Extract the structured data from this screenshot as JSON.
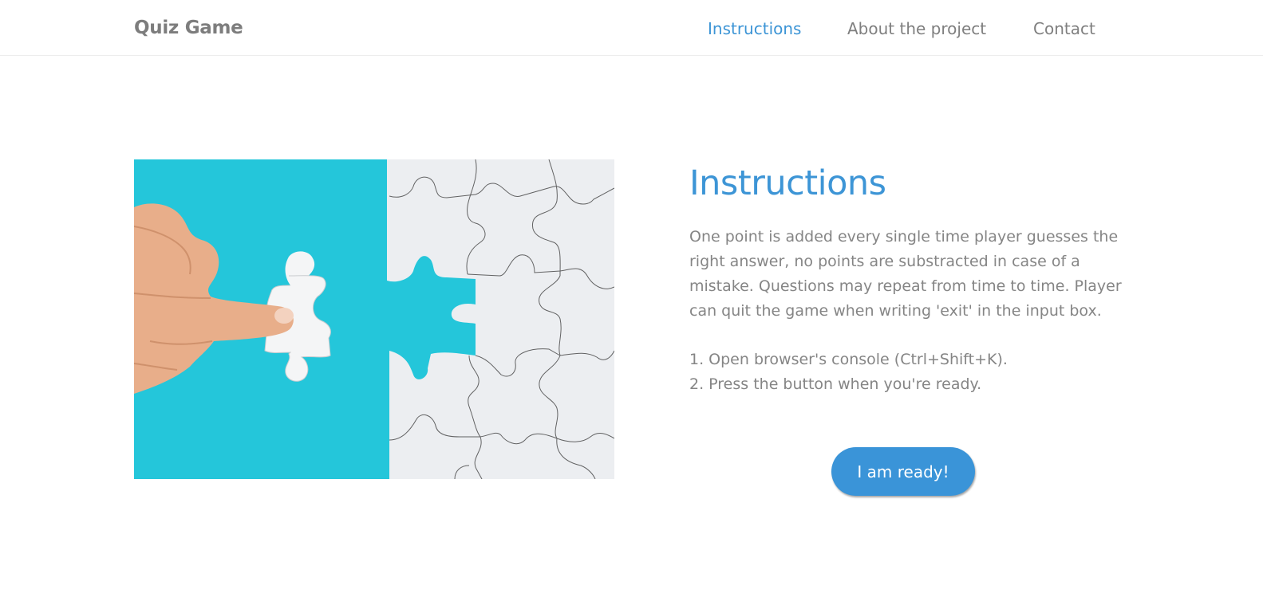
{
  "navbar": {
    "brand": "Quiz Game",
    "links": [
      {
        "label": "Instructions",
        "active": true
      },
      {
        "label": "About the project",
        "active": false
      },
      {
        "label": "Contact",
        "active": false
      }
    ]
  },
  "main": {
    "title": "Instructions",
    "description": "One point is added every single time player guesses the right answer, no points are substracted in case of a mistake. Questions may repeat from time to time. Player can quit the game when writing 'exit' in the input box.",
    "steps": [
      "1. Open browser's console (Ctrl+Shift+K).",
      "2. Press the button when you're ready."
    ],
    "button_label": "I am ready!"
  },
  "colors": {
    "accent": "#3d95d6",
    "button": "#3a94d8",
    "text": "#858585",
    "image_cyan": "#23c6da"
  },
  "image": {
    "icon": "puzzle-image"
  }
}
